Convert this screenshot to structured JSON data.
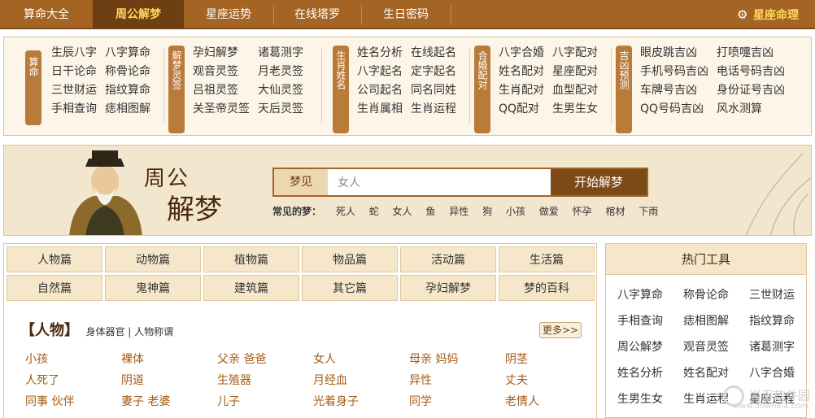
{
  "nav": {
    "items": [
      "算命大全",
      "周公解梦",
      "星座运势",
      "在线塔罗",
      "生日密码"
    ],
    "active_index": 1,
    "right_link": "星座命理"
  },
  "links": {
    "groups": [
      {
        "tag": "算命",
        "items": [
          "生辰八字",
          "八字算命",
          "日干论命",
          "称骨论命",
          "三世财运",
          "指纹算命",
          "手相查询",
          "痣相图解"
        ]
      },
      {
        "tag": "解梦灵签",
        "items": [
          "孕妇解梦",
          "诸葛测字",
          "观音灵签",
          "月老灵签",
          "吕祖灵签",
          "大仙灵签",
          "关圣帝灵签",
          "天后灵签"
        ]
      },
      {
        "tag": "生肖姓名",
        "items": [
          "姓名分析",
          "在线起名",
          "八字起名",
          "定字起名",
          "公司起名",
          "同名同姓",
          "生肖属相",
          "生肖运程"
        ]
      },
      {
        "tag": "合婚配对",
        "items": [
          "八字合婚",
          "八字配对",
          "姓名配对",
          "星座配对",
          "生肖配对",
          "血型配对",
          "QQ配对",
          "生男生女"
        ]
      },
      {
        "tag": "吉凶预测",
        "items": [
          "眼皮跳吉凶",
          "打喷嚏吉凶",
          "手机号码吉凶",
          "电话号码吉凶",
          "车牌号吉凶",
          "身份证号吉凶",
          "QQ号码吉凶",
          "风水测算"
        ]
      }
    ]
  },
  "banner": {
    "logo_line1": "周公",
    "logo_line2": "解梦",
    "search_label": "梦见",
    "search_value": "女人",
    "search_button": "开始解梦",
    "common_label": "常见的梦：",
    "common_dreams": [
      "死人",
      "蛇",
      "女人",
      "鱼",
      "异性",
      "狗",
      "小孩",
      "做爱",
      "怀孕",
      "棺材",
      "下雨"
    ]
  },
  "categories": [
    "人物篇",
    "动物篇",
    "植物篇",
    "物品篇",
    "活动篇",
    "生活篇",
    "自然篇",
    "鬼神篇",
    "建筑篇",
    "其它篇",
    "孕妇解梦",
    "梦的百科"
  ],
  "people": {
    "title": "【人物】",
    "sub": "身体器官 | 人物称谓",
    "more": "更多>>",
    "words": [
      "小孩",
      "裸体",
      "父亲 爸爸",
      "女人",
      "母亲 妈妈",
      "阴茎",
      "人死了",
      "阴道",
      "生殖器",
      "月经血",
      "异性",
      "丈夫",
      "同事 伙伴",
      "妻子 老婆",
      "儿子",
      "光着身子",
      "同学",
      "老情人"
    ]
  },
  "hot_tools": {
    "title": "热门工具",
    "items": [
      "八字算命",
      "称骨论命",
      "三世财运",
      "手相查询",
      "痣相图解",
      "指纹算命",
      "周公解梦",
      "观音灵签",
      "诸葛测字",
      "姓名分析",
      "姓名配对",
      "八字合婚",
      "生男生女",
      "生肖运程",
      "星座运程"
    ]
  },
  "watermark": {
    "text": "当下软件园",
    "sub": "www.downxia.com"
  }
}
